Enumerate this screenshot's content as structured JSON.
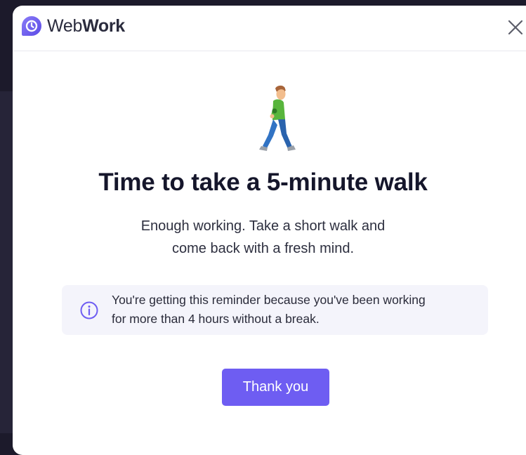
{
  "app": {
    "brand_light": "Web",
    "brand_bold": "Work",
    "logo_icon": "webwork-clock-logo-icon",
    "accent_color": "#6e5df2"
  },
  "header": {
    "close_icon": "close-icon"
  },
  "reminder": {
    "illustration_icon": "person-walking-icon",
    "title": "Time to take a 5-minute walk",
    "subtitle_line1": "Enough working. Take a short walk and",
    "subtitle_line2": "come back with a fresh mind."
  },
  "info": {
    "icon": "info-icon",
    "line1": "You're getting this reminder because you've been working",
    "line2": "for more than 4 hours without a break."
  },
  "actions": {
    "confirm_label": "Thank you"
  }
}
